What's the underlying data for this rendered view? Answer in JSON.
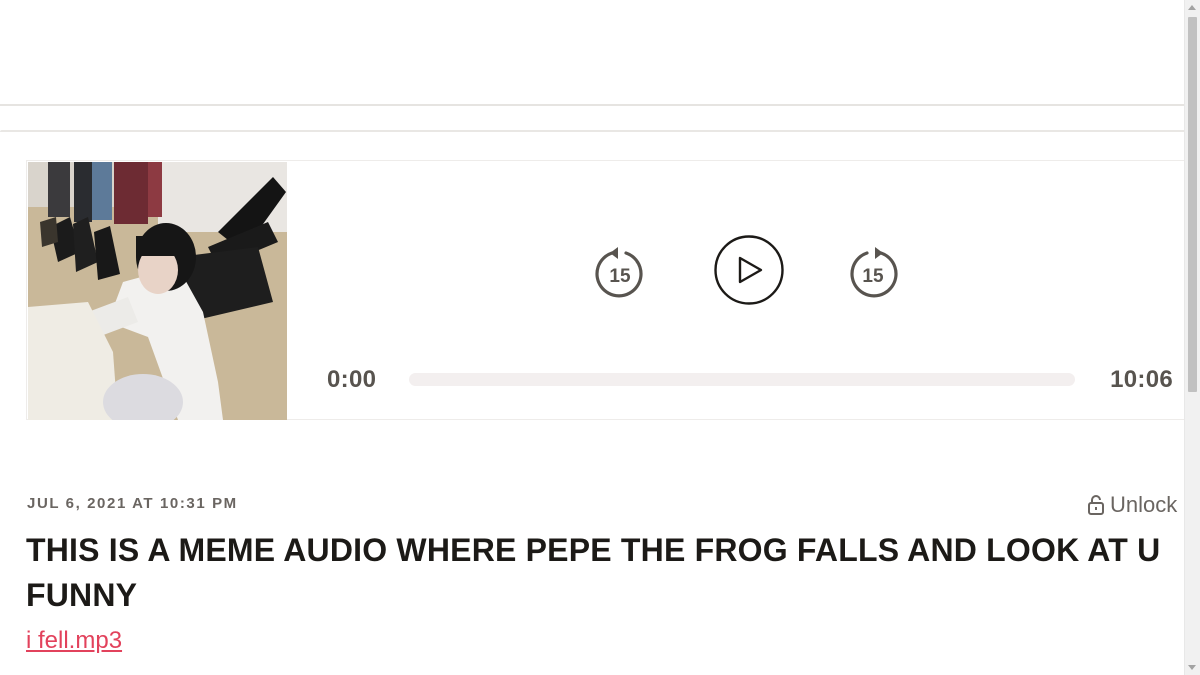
{
  "player": {
    "cover_alt": "Episode cover image",
    "skip_back_seconds": "15",
    "skip_forward_seconds": "15",
    "current_time": "0:00",
    "duration": "10:06",
    "progress_fraction": 0
  },
  "post": {
    "date": "JUL 6, 2021 AT 10:31 PM",
    "unlock_label": "Unlock",
    "title": "THIS IS A MEME AUDIO WHERE PEPE THE FROG FALLS AND LOOK AT U FUNNY",
    "attachment": "i fell.mp3"
  },
  "colors": {
    "link": "#e2425c",
    "title": "#1c1a17",
    "meta": "#6a6561"
  },
  "icons": {
    "lock": "unlock-icon",
    "back": "rewind-15-icon",
    "play": "play-icon",
    "forward": "forward-15-icon"
  }
}
